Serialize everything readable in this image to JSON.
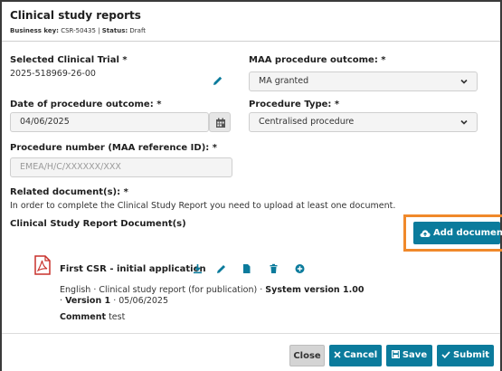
{
  "header": {
    "title": "Clinical study reports",
    "business_key_label": "Business key:",
    "business_key": "CSR-50435",
    "separator": "|",
    "status_label": "Status:",
    "status": "Draft"
  },
  "form": {
    "clinical_trial_label": "Selected Clinical Trial *",
    "clinical_trial_value": "2025-518969-26-00",
    "maa_outcome_label": "MAA procedure outcome: *",
    "maa_outcome_value": "MA granted",
    "date_label": "Date of procedure outcome: *",
    "date_value": "04/06/2025",
    "procedure_type_label": "Procedure Type: *",
    "procedure_type_value": "Centralised procedure",
    "procedure_number_label": "Procedure number (MAA reference ID): *",
    "procedure_number_placeholder": "EMEA/H/C/XXXXXX/XXX",
    "related_docs_label": "Related document(s): *",
    "related_docs_hint": "In order to complete the Clinical Study Report you need to upload at least one document.",
    "csr_documents_label": "Clinical Study Report Document(s)",
    "add_document_label": "Add document"
  },
  "document": {
    "title": "First CSR - initial application",
    "language": "English",
    "dot": "·",
    "type": "Clinical study report (for publication)",
    "system_version": "System version 1.00",
    "version": "Version 1",
    "date": "05/06/2025",
    "comment_label": "Comment",
    "comment": "test"
  },
  "footer": {
    "close_label": "Close",
    "cancel_label": "Cancel",
    "save_label": "Save",
    "submit_label": "Submit"
  },
  "colors": {
    "primary": "#0b7b9c",
    "highlight": "#f0892b",
    "pdf_red": "#c8312b"
  }
}
